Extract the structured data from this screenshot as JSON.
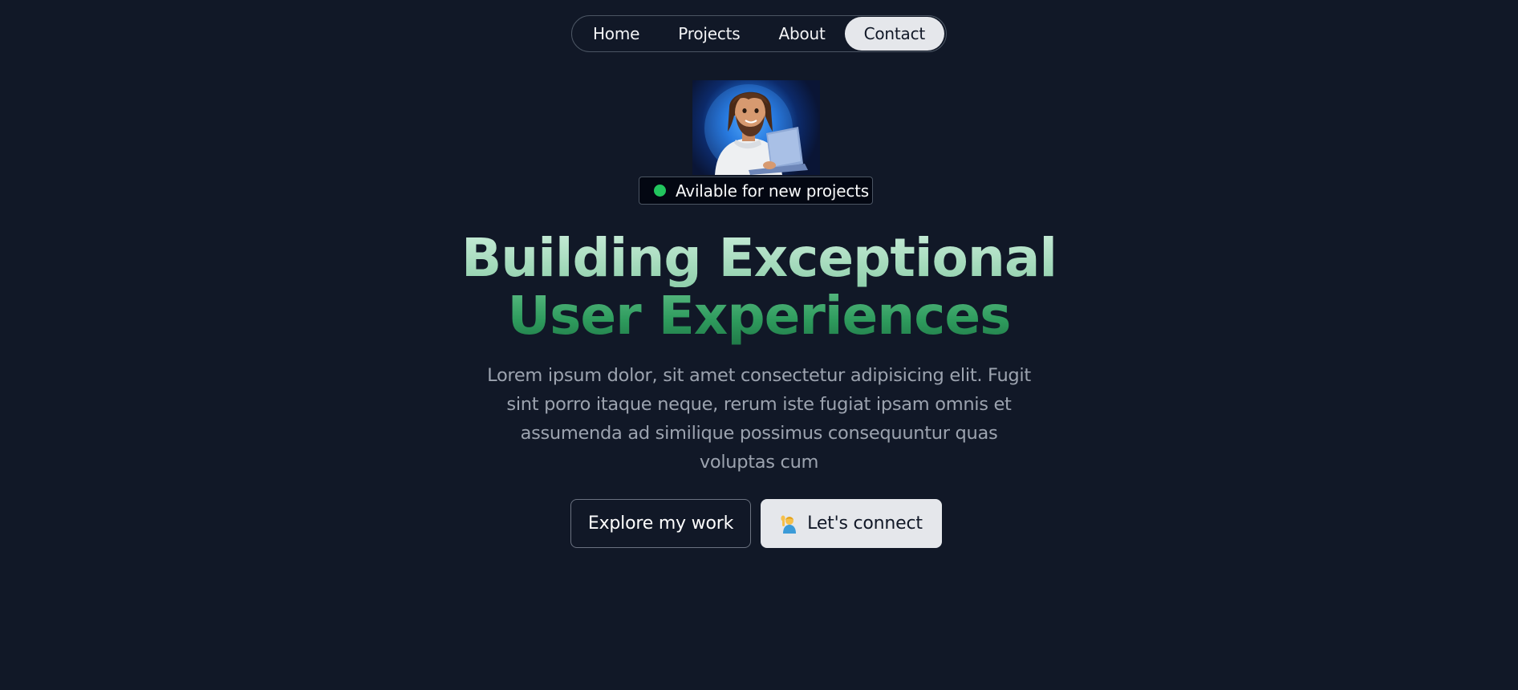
{
  "nav": {
    "items": [
      {
        "label": "Home",
        "active": false
      },
      {
        "label": "Projects",
        "active": false
      },
      {
        "label": "About",
        "active": false
      },
      {
        "label": "Contact",
        "active": true
      }
    ]
  },
  "hero": {
    "status_badge": "Avilable for new projects",
    "status_color": "#22c55e",
    "headline_line1": "Building Exceptional",
    "headline_line2": "User Experiences",
    "intro": "Lorem ipsum dolor, sit amet consectetur adipisicing elit. Fugit sint porro itaque neque, rerum iste fugiat ipsam omnis et assumenda ad similique possimus consequuntur quas voluptas cum",
    "primary_button": "Explore my work",
    "secondary_button": "Let's connect",
    "secondary_button_icon": "person-raising-hand-icon"
  },
  "colors": {
    "background": "#111827",
    "headline_light": "#a6dbbd",
    "headline_dark": "#2f9c5e"
  }
}
